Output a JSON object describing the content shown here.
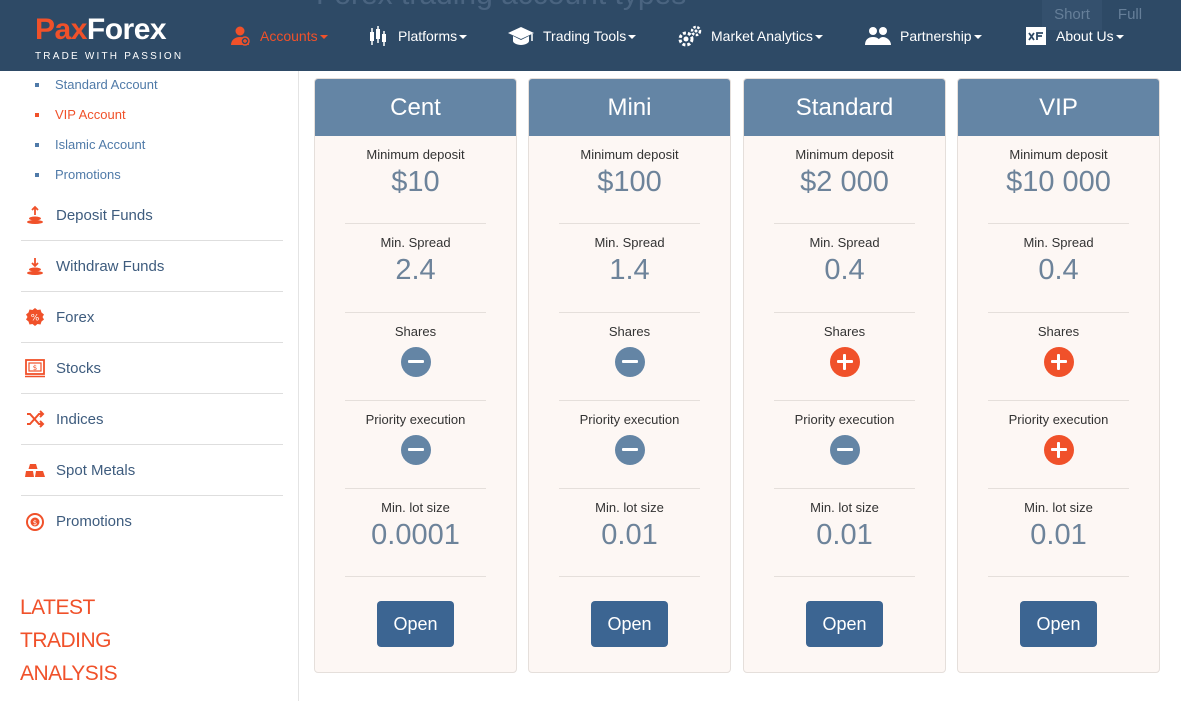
{
  "header": {
    "ghost_title": "Forex trading account types",
    "ghost_buttons": [
      "Short",
      "Full"
    ],
    "logo_part1": "Pax",
    "logo_part2": "Forex",
    "tagline": "TRADE WITH PASSION",
    "nav": [
      {
        "label": "Accounts",
        "icon": "accounts-icon",
        "active": true
      },
      {
        "label": "Platforms",
        "icon": "platforms-icon"
      },
      {
        "label": "Trading Tools",
        "icon": "graduation-cap-icon"
      },
      {
        "label": "Market Analytics",
        "icon": "gears-icon"
      },
      {
        "label": "Partnership",
        "icon": "partners-icon"
      },
      {
        "label": "About Us",
        "icon": "xf-icon"
      }
    ]
  },
  "sidebar": {
    "sub_items": [
      {
        "label": "Standard Account"
      },
      {
        "label": "VIP Account",
        "active": true
      },
      {
        "label": "Islamic Account"
      },
      {
        "label": "Promotions"
      }
    ],
    "menu": [
      {
        "label": "Deposit Funds",
        "icon": "coins-up-icon"
      },
      {
        "label": "Withdraw Funds",
        "icon": "coins-down-icon"
      },
      {
        "label": "Forex",
        "icon": "percent-badge-icon"
      },
      {
        "label": "Stocks",
        "icon": "stock-certificate-icon"
      },
      {
        "label": "Indices",
        "icon": "shuffle-icon"
      },
      {
        "label": "Spot Metals",
        "icon": "gold-bars-icon"
      },
      {
        "label": "Promotions",
        "icon": "promo-coin-icon"
      }
    ],
    "latest_lines": [
      "LATEST",
      "TRADING",
      "ANALYSIS"
    ]
  },
  "labels": {
    "min_deposit": "Minimum deposit",
    "min_spread": "Min. Spread",
    "shares": "Shares",
    "priority": "Priority execution",
    "min_lot": "Min. lot size"
  },
  "accounts": [
    {
      "name": "Cent",
      "deposit": "$10",
      "spread": "2.4",
      "shares": false,
      "priority": false,
      "lot": "0.0001",
      "button": "Open"
    },
    {
      "name": "Mini",
      "deposit": "$100",
      "spread": "1.4",
      "shares": false,
      "priority": false,
      "lot": "0.01",
      "button": "Open"
    },
    {
      "name": "Standard",
      "deposit": "$2 000",
      "spread": "0.4",
      "shares": true,
      "priority": false,
      "lot": "0.01",
      "button": "Open"
    },
    {
      "name": "VIP",
      "deposit": "$10 000",
      "spread": "0.4",
      "shares": true,
      "priority": true,
      "lot": "0.01",
      "button": "Open"
    }
  ],
  "colors": {
    "header_bg": "#2e4a66",
    "accent": "#f0512a",
    "card_head": "#6485a5",
    "button": "#3c6592",
    "minus": "#6485a5",
    "plus": "#f0512a"
  }
}
